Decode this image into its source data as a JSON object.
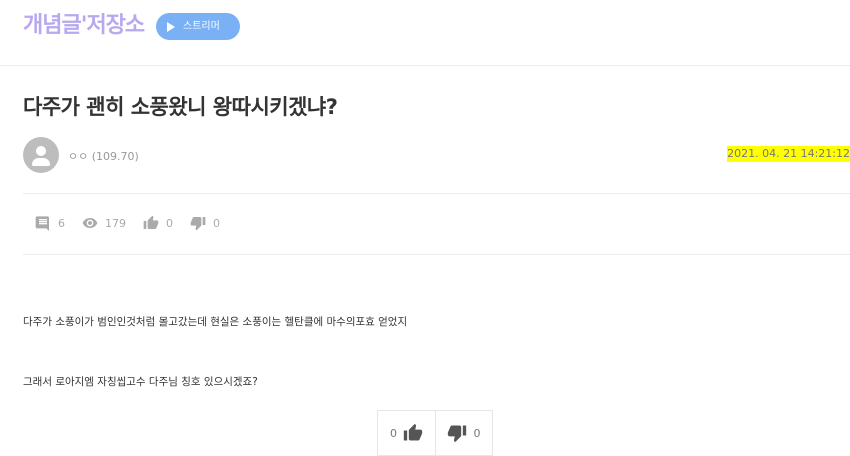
{
  "header": {
    "logo_text": "개념글'저장소",
    "streamer_label": "스트리머"
  },
  "post": {
    "title": "다주가 괜히 소풍왔니 왕따시키겠냐?",
    "author": "ㅇㅇ (109.70)",
    "date": "2021. 04. 21 14:21:12",
    "stats": {
      "comments": "6",
      "views": "179",
      "likes": "0",
      "dislikes": "0"
    },
    "body_lines": [
      "다주가 소풍이가 범인인것처럼 몰고갔는데 현실은 소풍이는 헬탄클에 마수의포효 얻었지",
      "그래서 로아지엠 자칭씹고수 다주님 칭호 있으시겠죠?"
    ],
    "vote": {
      "up": "0",
      "down": "0"
    }
  },
  "colors": {
    "logo": "#b9a8ef",
    "streamer_button": "#7ab0f4",
    "date_highlight": "#ffff00",
    "icon_gray": "#aaaaaa"
  },
  "icons": [
    "play-icon",
    "comment-icon",
    "eye-icon",
    "thumbs-up-icon",
    "thumbs-down-icon",
    "avatar-person-icon"
  ]
}
